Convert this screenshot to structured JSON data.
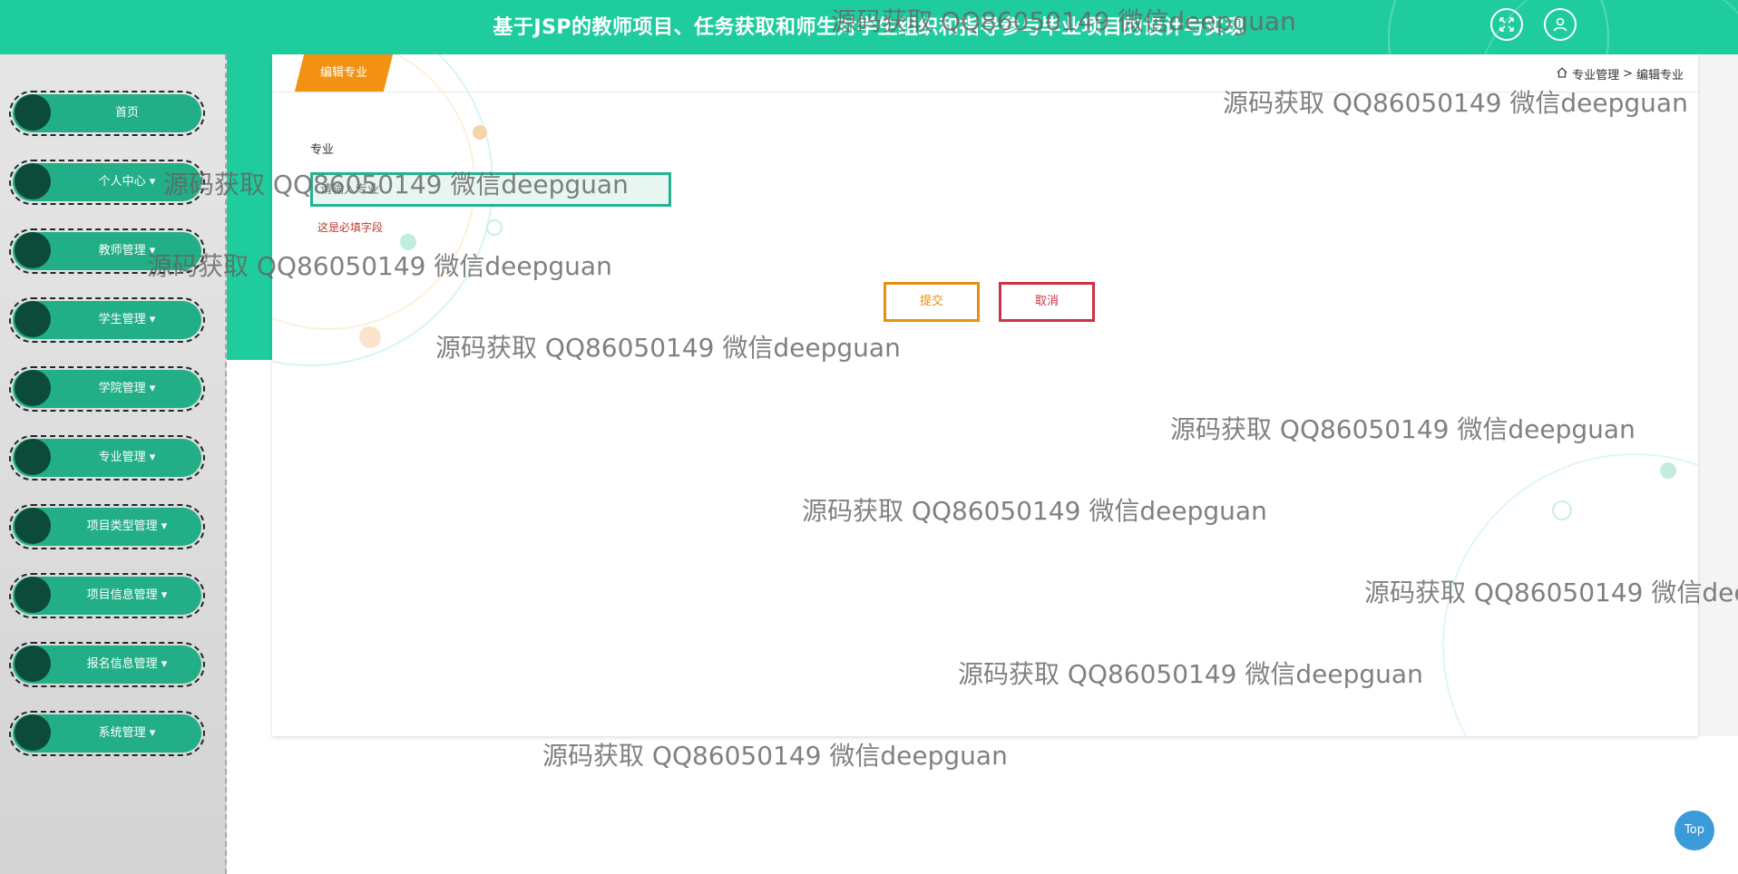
{
  "header": {
    "title": "基于JSP的教师项目、任务获取和师生对学生组织和指导参与毕业项目的设计与实现"
  },
  "sidebar": {
    "items": [
      {
        "label": "首页"
      },
      {
        "label": "个人中心 ▾"
      },
      {
        "label": "教师管理 ▾"
      },
      {
        "label": "学生管理 ▾"
      },
      {
        "label": "学院管理 ▾"
      },
      {
        "label": "专业管理 ▾"
      },
      {
        "label": "项目类型管理 ▾"
      },
      {
        "label": "项目信息管理 ▾"
      },
      {
        "label": "报名信息管理 ▾"
      },
      {
        "label": "系统管理 ▾"
      }
    ]
  },
  "panel": {
    "tab_label": "编辑专业",
    "breadcrumb": {
      "section": "专业管理",
      "separator": ">",
      "current": "编辑专业"
    }
  },
  "form": {
    "field_label": "专业",
    "field_value": "",
    "field_placeholder": "请输入专业",
    "error_text": "这是必填字段",
    "submit_label": "提交",
    "cancel_label": "取消"
  },
  "watermark_text": "源码获取 QQ86050149 微信deepguan",
  "top_button_label": "Top",
  "colors": {
    "accent": "#1fcc9d",
    "sidebar_item": "#22ae86",
    "tab": "#f39212",
    "submit": "#e8900e",
    "cancel": "#cc3344",
    "error": "#c0392b",
    "top_button": "#3b9ad8"
  }
}
